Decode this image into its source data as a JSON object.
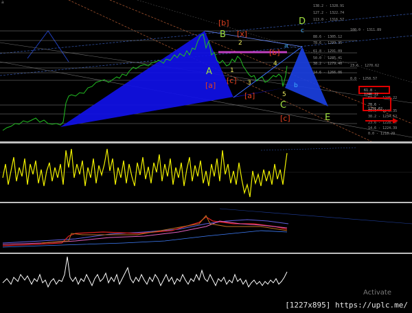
{
  "corner_mark": "a",
  "wave_labels": {
    "b_bracket_top": "[b]",
    "x_bracket": "[x]",
    "b_bracket_mid": "[b]",
    "a_bracket_1": "[a]",
    "a_bracket_2": "[a]",
    "c_bracket_1": "[c]",
    "c_bracket_2": "[c]",
    "A": "A",
    "B": "B",
    "C": "C",
    "D": "D",
    "E": "E",
    "n1": "1",
    "n2": "2",
    "n3": "3",
    "n4": "4",
    "n5": "5",
    "a_small": "a",
    "b_small": "b",
    "c_small": "c"
  },
  "fib_levels": [
    "138.2 - 1328.91",
    "127.2 - 1322.74",
    "113.0 - 1316.57",
    "100.0 - 1311.89",
    "88.6 - 1305.12",
    "78.6 - 1299.35",
    "61.8 - 1291.09",
    "50.0 - 1285.41",
    "38.2 - 1279.40",
    "23.6 - 1270.62",
    "14.6 - 1266.06",
    "0.0 - 1258.57",
    "61.8 - 1246.22",
    "50.0 - 1240.35",
    "38.2 - 1234.52",
    "23.6 - 1228.47",
    "14.6 - 1224.39",
    "0.0 - 1218.29"
  ],
  "highlight_levels": [
    "61.8 - 1246.22",
    "78.6 - 1251.62"
  ],
  "watermark": "Activate",
  "footer_text": "[1227x895] https://uplc.me/",
  "colors": {
    "price": "#22c022",
    "pattern_fill": "#1010e8",
    "pattern_light": "#2a7fd8",
    "osc_yellow": "#f2f200",
    "osc_white": "#ffffff",
    "accent_red": "#e00000"
  }
}
